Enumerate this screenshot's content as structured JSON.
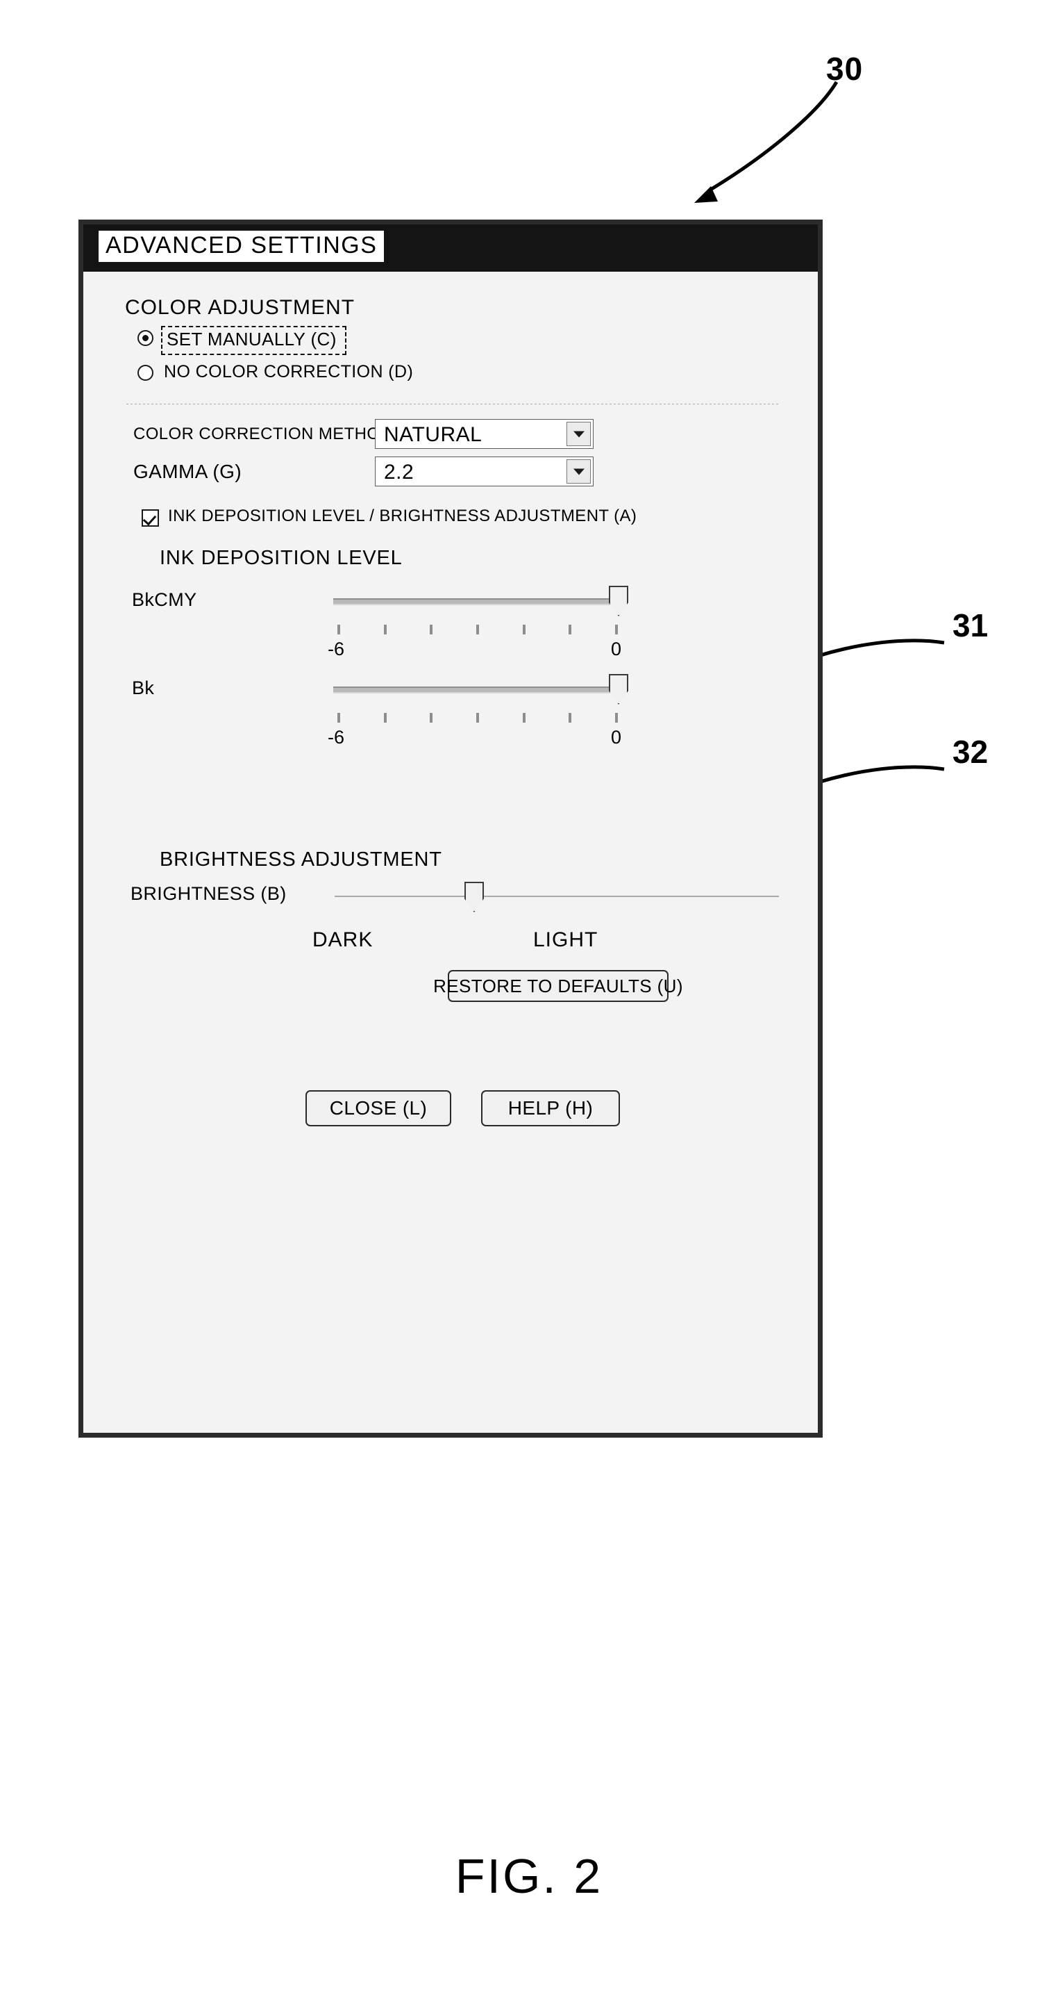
{
  "figure": {
    "caption": "FIG. 2",
    "reference_numerals": [
      {
        "id": "30",
        "label": "30",
        "points_to": "advanced-settings-dialog"
      },
      {
        "id": "31",
        "label": "31",
        "points_to": "bkcmy-slider-thumb"
      },
      {
        "id": "32",
        "label": "32",
        "points_to": "bk-slider-thumb"
      }
    ]
  },
  "dialog": {
    "title": "ADVANCED SETTINGS",
    "sections": {
      "color_adjustment": {
        "heading": "COLOR ADJUSTMENT",
        "radios": [
          {
            "label": "SET MANUALLY (C)",
            "accel": "C",
            "selected": true,
            "focused": true
          },
          {
            "label": "NO COLOR CORRECTION (D)",
            "accel": "D",
            "selected": false,
            "focused": false
          }
        ],
        "fields": [
          {
            "label": "COLOR CORRECTION METHOD (O)",
            "accel": "O",
            "control": "combobox",
            "value": "NATURAL"
          },
          {
            "label": "GAMMA (G)",
            "accel": "G",
            "control": "combobox",
            "value": "2.2"
          }
        ]
      },
      "ink_brightness": {
        "checkbox": {
          "label": "INK DEPOSITION LEVEL / BRIGHTNESS ADJUSTMENT (A)",
          "accel": "A",
          "checked": true
        },
        "ink_deposition": {
          "heading": "INK DEPOSITION LEVEL",
          "sliders": [
            {
              "label": "BkCMY",
              "accel": "Y",
              "min_label": "-6",
              "max_label": "0",
              "min": -6,
              "max": 0,
              "value": 0,
              "tick_count": 7
            },
            {
              "label": "Bk",
              "accel": "k",
              "min_label": "-6",
              "max_label": "0",
              "min": -6,
              "max": 0,
              "value": 0,
              "tick_count": 7
            }
          ]
        },
        "brightness": {
          "heading": "BRIGHTNESS ADJUSTMENT",
          "slider": {
            "label": "BRIGHTNESS (B)",
            "accel": "B",
            "min_label": "DARK",
            "max_label": "LIGHT",
            "value_percent": 30
          }
        },
        "restore_button": "RESTORE TO DEFAULTS (U)"
      }
    },
    "footer_buttons": [
      {
        "label": "CLOSE (L)",
        "accel": "L"
      },
      {
        "label": "HELP (H)",
        "accel": "H"
      }
    ]
  }
}
